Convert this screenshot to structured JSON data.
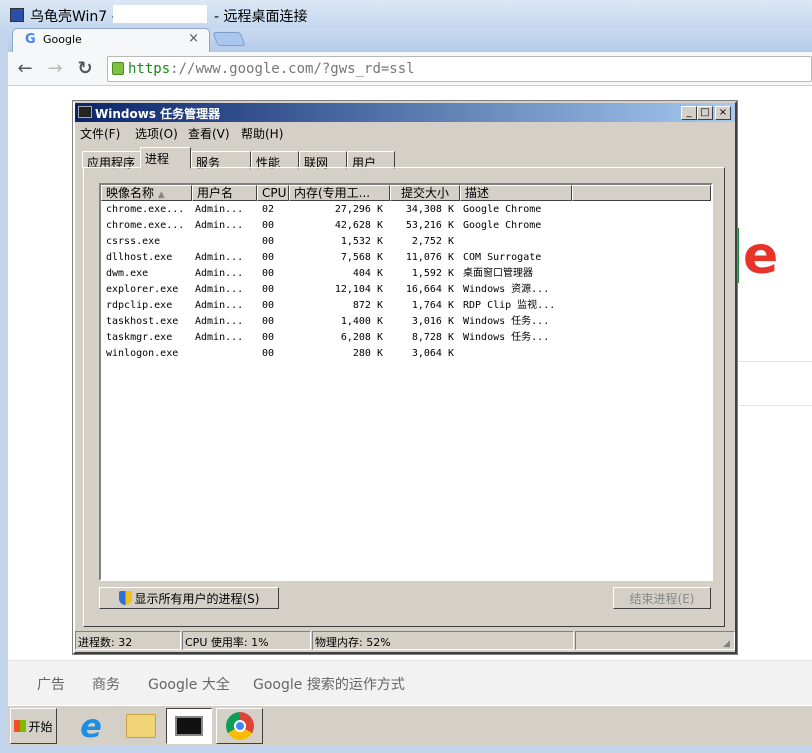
{
  "rdp": {
    "title_left": "乌龟壳Win7 -",
    "title_right": "- 远程桌面连接"
  },
  "browser": {
    "tab_title": "Google",
    "tab_close": "×",
    "url_scheme": "https",
    "url_rest": "://www.google.com/?gws_rd=ssl",
    "back": "←",
    "forward": "→",
    "reload": "↻"
  },
  "footer": {
    "links": [
      "广告",
      "商务",
      "Google 大全",
      "Google 搜索的运作方式"
    ]
  },
  "taskbar": {
    "start": "开始"
  },
  "taskmgr": {
    "title": "Windows 任务管理器",
    "menu": [
      "文件(F)",
      "选项(O)",
      "查看(V)",
      "帮助(H)"
    ],
    "tabs": [
      "应用程序",
      "进程",
      "服务",
      "性能",
      "联网",
      "用户"
    ],
    "columns": [
      "映像名称",
      "用户名",
      "CPU",
      "内存(专用工...",
      "提交大小",
      "描述",
      ""
    ],
    "rows": [
      [
        "chrome.exe...",
        "Admin...",
        "02",
        "27,296 K",
        "34,308 K",
        "Google Chrome"
      ],
      [
        "chrome.exe...",
        "Admin...",
        "00",
        "42,628 K",
        "53,216 K",
        "Google Chrome"
      ],
      [
        "csrss.exe",
        "",
        "00",
        "1,532 K",
        "2,752 K",
        ""
      ],
      [
        "dllhost.exe",
        "Admin...",
        "00",
        "7,568 K",
        "11,076 K",
        "COM Surrogate"
      ],
      [
        "dwm.exe",
        "Admin...",
        "00",
        "404 K",
        "1,592 K",
        "桌面窗口管理器"
      ],
      [
        "explorer.exe",
        "Admin...",
        "00",
        "12,104 K",
        "16,664 K",
        "Windows 资源..."
      ],
      [
        "rdpclip.exe",
        "Admin...",
        "00",
        "872 K",
        "1,764 K",
        "RDP Clip 监视..."
      ],
      [
        "taskhost.exe",
        "Admin...",
        "00",
        "1,400 K",
        "3,016 K",
        "Windows 任务..."
      ],
      [
        "taskmgr.exe",
        "Admin...",
        "00",
        "6,208 K",
        "8,728 K",
        "Windows 任务..."
      ],
      [
        "winlogon.exe",
        "",
        "00",
        "280 K",
        "3,064 K",
        ""
      ]
    ],
    "show_all_button": "显示所有用户的进程(S)",
    "end_process_button": "结束进程(E)",
    "status": {
      "processes": "进程数: 32",
      "cpu": "CPU 使用率: 1%",
      "memory": "物理内存: 52%"
    }
  }
}
